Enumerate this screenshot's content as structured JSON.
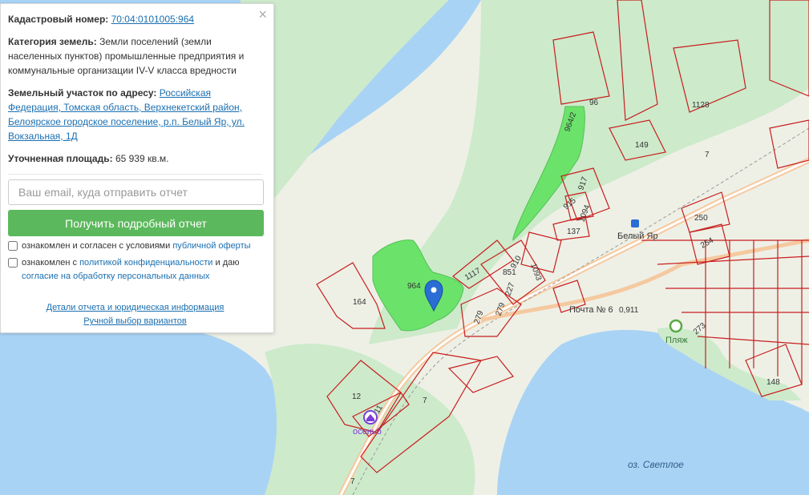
{
  "panel": {
    "close_glyph": "×",
    "cadastral_label": "Кадастровый номер:",
    "cadastral_value": "70:04:0101005:964",
    "category_label": "Категория земель:",
    "category_value": "Земли поселений (земли населенных пунктов) промышленные предприятия и коммунальные организации IV-V класса вредности",
    "address_label": "Земельный участок по адресу:",
    "address_value": "Российская Федерация, Томская область, Верхнекетский район, Белоярское городское поселение, р.п. Белый Яр, ул. Вокзальная, 1Д",
    "area_label": "Уточненная площадь:",
    "area_value": "65 939 кв.м.",
    "email_placeholder": "Ваш email, куда отправить отчет",
    "submit_label": "Получить подробный отчет",
    "agree1_prefix": "ознакомлен и согласен с условиями",
    "agree1_link": "публичной оферты",
    "agree2_prefix": "ознакомлен с",
    "agree2_link": "политикой конфиденциальности",
    "agree2_mid": "и даю",
    "agree2_link2": "согласие на обработку персональных данных",
    "details_link": "Детали отчета и юридическая информация",
    "manual_link": "Ручной выбор вариантов"
  },
  "map": {
    "colors": {
      "water": "#a9d3f5",
      "green": "#cdeacb",
      "land": "#eef0e6",
      "parcel": "#c81e1e",
      "selected": "#6be36b",
      "marker": "#2a6dd4"
    },
    "labels": {
      "selected": "964",
      "p964_2": "964/2",
      "p96": "96",
      "p1128": "1128",
      "p149": "149",
      "p7a": "7",
      "p917": "917",
      "p915": "915",
      "p1094": "1094",
      "p137": "137",
      "p1117": "1117",
      "p910": "910",
      "p851": "851",
      "p227": "227",
      "p1093": "1093",
      "p279a": "279",
      "p279b": "279",
      "p164": "164",
      "p12": "12",
      "p11": "11",
      "p7b": "7",
      "p7c": "7",
      "p250": "250",
      "p254": "254",
      "p273": "273",
      "p148": "148",
      "station": "Белый Яр",
      "post": "Почта № 6",
      "p911": "0,911",
      "beach": "Пляж",
      "place": "осеньб",
      "lake": "оз. Светлое"
    }
  }
}
